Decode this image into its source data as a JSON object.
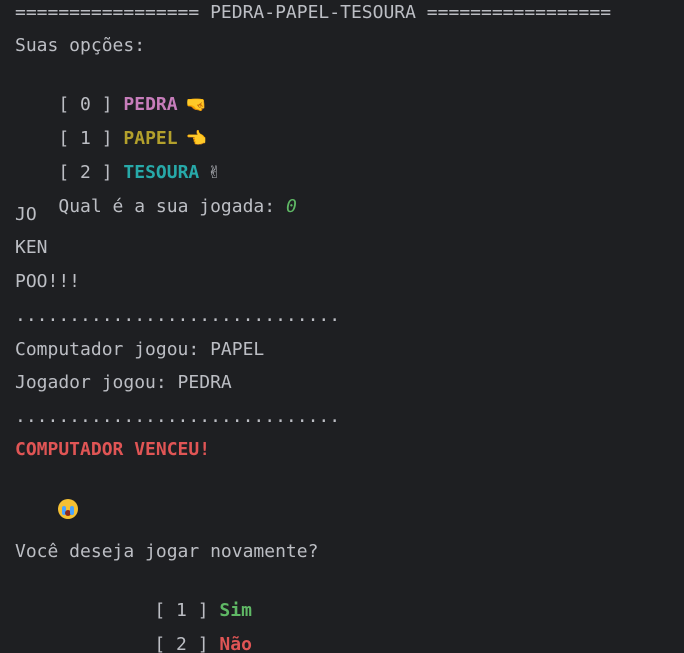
{
  "header": "================= PEDRA-PAPEL-TESOURA =================",
  "options_title": "Suas opções:",
  "options": [
    {
      "bracket": "[ 0 ] ",
      "label": "PEDRA",
      "color": "#c77dbb",
      "emoji": "🤜"
    },
    {
      "bracket": "[ 1 ] ",
      "label": "PAPEL",
      "color": "#b3a02c",
      "emoji": "👈"
    },
    {
      "bracket": "[ 2 ] ",
      "label": "TESOURA",
      "color": "#27a9a9",
      "emoji": "✌"
    }
  ],
  "prompt": "Qual é a sua jogada: ",
  "prompt_value": "0",
  "prompt_value_color": "#5fb865",
  "chant": [
    "JO",
    "KEN",
    "POO!!!"
  ],
  "separator": "..............................",
  "computer_played": "Computador jogou: PAPEL",
  "player_played": "Jogador jogou: PEDRA",
  "result": "COMPUTADOR VENCEU!",
  "result_color": "#e05555",
  "result_icon": "crying-face",
  "play_again_question": "Você deseja jogar novamente?",
  "play_again_options": [
    {
      "bracket": "[ 1 ] ",
      "label": "Sim",
      "color": "#5fb865"
    },
    {
      "bracket": "[ 2 ] ",
      "label": "Não",
      "color": "#e05555"
    }
  ]
}
